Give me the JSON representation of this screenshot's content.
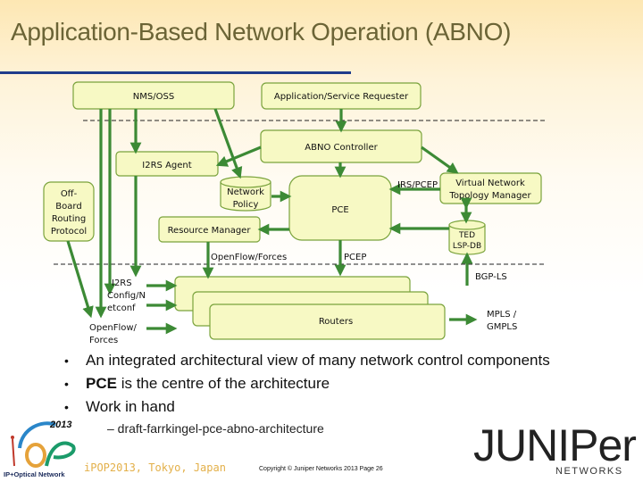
{
  "slide": {
    "title": "Application-Based Network Operation (ABNO)"
  },
  "diagram": {
    "boxes": {
      "nms_oss": "NMS/OSS",
      "app_requester": "Application/Service Requester",
      "abno_controller": "ABNO Controller",
      "i2rs_agent": "I2RS Agent",
      "offboard_routing": [
        "Off-",
        "Board",
        "Routing",
        "Protocol"
      ],
      "network_policy": [
        "Network",
        "Policy"
      ],
      "pce": "PCE",
      "vntm": [
        "Virtual Network",
        "Topology Manager"
      ],
      "resource_manager": "Resource Manager",
      "ted_lspdb": [
        "TED",
        "LSP-DB"
      ],
      "routers": "Routers"
    },
    "labels": {
      "irs_pcep": "IRS/PCEP",
      "openflow_forces": "OpenFlow/Forces",
      "pcep": "PCEP",
      "bgp_ls": "BGP-LS",
      "i2rs": "I2RS",
      "config_netconf": [
        "Config/N",
        "etconf"
      ],
      "openflow_forces_left": [
        "OpenFlow/",
        "Forces"
      ],
      "mpls_gmpls": [
        "MPLS /",
        "GMPLS"
      ]
    }
  },
  "bullets": [
    "An integrated architectural view of many network control components",
    "PCE is the centre of the architecture",
    "Work in hand"
  ],
  "bullet_bold_prefix": "PCE",
  "bullet_2_rest": " is the centre of the architecture",
  "sub_bullet": "–   draft-farrkingel-pce-abno-architecture",
  "footer": {
    "venue": "iPOP2013, Tokyo, Japan",
    "copyright": "Copyright © Juniper Networks 2013 Page 26",
    "juniper_logo": "JUNIPer",
    "juniper_sub": "NETWORKS",
    "ipop_year": "2013",
    "ipop_caption": "IP+Optical Network"
  },
  "colors": {
    "title": "#6b6436",
    "title_rule": "#1f3d8c",
    "box_fill": "#f7f9c4",
    "box_stroke": "#7aa33c",
    "arrow": "#3c8a35"
  }
}
